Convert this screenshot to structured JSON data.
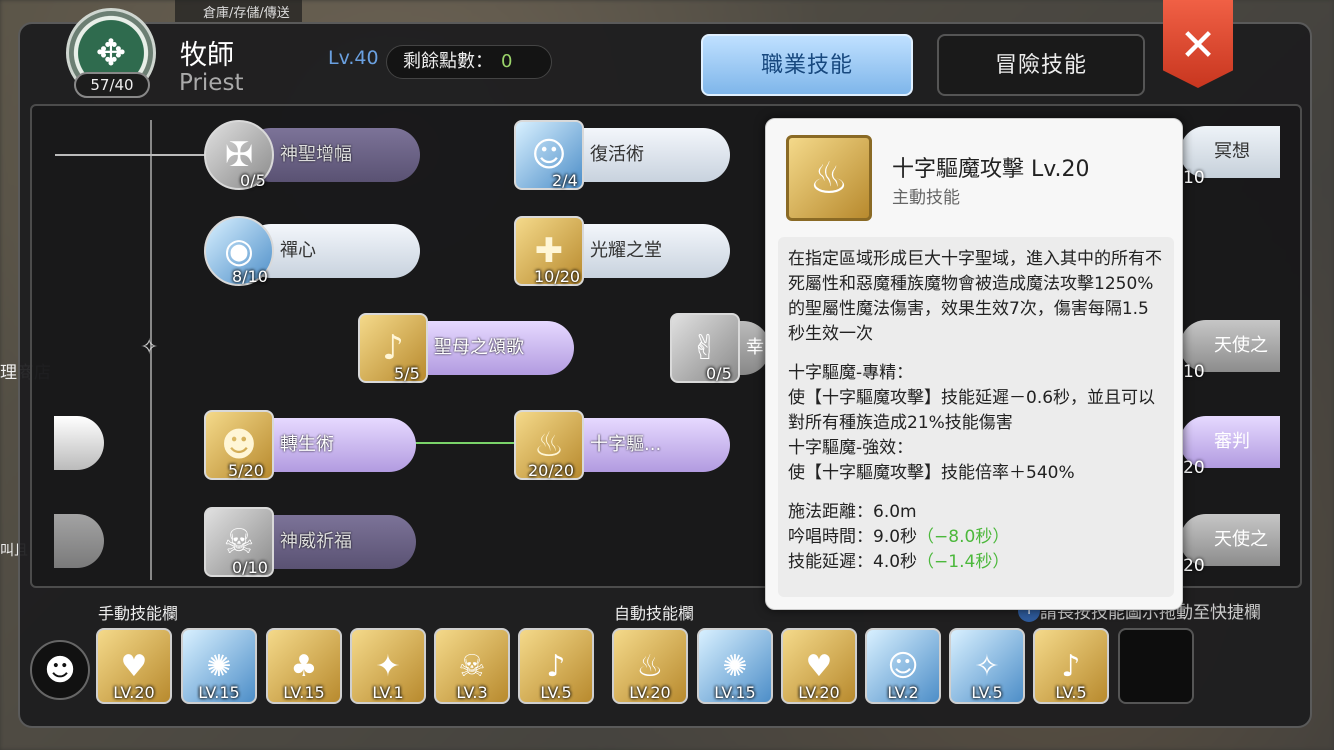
{
  "background": {
    "top_hint": "倉庫/存儲/傳送",
    "left_hint": "理商店",
    "left_hint2": "叫且"
  },
  "header": {
    "emblem_count": "57/40",
    "job_name": "牧師",
    "job_name_en": "Priest",
    "level": "Lv.40",
    "points_label": "剩餘點數：",
    "points_value": "0",
    "tab_job": "職業技能",
    "tab_adventure": "冒險技能",
    "close_label": "✕"
  },
  "skills": [
    {
      "name": "神聖增幅",
      "count": "0/5"
    },
    {
      "name": "禪心",
      "count": "8/10"
    },
    {
      "name": "復活術",
      "count": "2/4"
    },
    {
      "name": "光耀之堂",
      "count": "10/20"
    },
    {
      "name": "聖母之頌歌",
      "count": "5/5"
    },
    {
      "name": "幸",
      "count": "0/5"
    },
    {
      "name": "轉生術",
      "count": "5/20"
    },
    {
      "name": "十字驅...",
      "count": "20/20"
    },
    {
      "name": "神威祈福",
      "count": "0/10"
    },
    {
      "name": "冥想",
      "count": "10"
    },
    {
      "name": "天使之",
      "count": "10"
    },
    {
      "name": "審判",
      "count": "20"
    },
    {
      "name": "天使之",
      "count": "20"
    }
  ],
  "tooltip": {
    "name": "十字驅魔攻擊  Lv.20",
    "type": "主動技能",
    "desc": "在指定區域形成巨大十字聖域，進入其中的所有不死屬性和惡魔種族魔物會被造成魔法攻擊1250%的聖屬性魔法傷害，效果生效7次，傷害每隔1.5秒生效一次",
    "spec1_title": "十字驅魔-專精：",
    "spec1_body": "使【十字驅魔攻擊】技能延遲－0.6秒，並且可以對所有種族造成21%技能傷害",
    "spec2_title": "十字驅魔-強效：",
    "spec2_body": "使【十字驅魔攻擊】技能倍率＋540%",
    "range": "施法距離：6.0m",
    "cast": "吟唱時間：9.0秒",
    "cast_mod": "（−8.0秒）",
    "delay": "技能延遲：4.0秒",
    "delay_mod": "（−1.4秒）"
  },
  "bottom": {
    "manual_label": "手動技能欄",
    "auto_label": "自動技能欄",
    "drag_hint": "請長按技能圖示拖動至快捷欄",
    "hint_icon": "i",
    "manual_slots": [
      "LV.20",
      "LV.15",
      "LV.15",
      "LV.1",
      "LV.3",
      "LV.5"
    ],
    "auto_slots": [
      "LV.20",
      "LV.15",
      "LV.20",
      "LV.2",
      "LV.5",
      "LV.5"
    ]
  },
  "colors": {
    "accent_blue": "#7fb6ea",
    "close_red": "#e0472c",
    "gold": "#d4ae55",
    "green": "#7ad36a"
  }
}
